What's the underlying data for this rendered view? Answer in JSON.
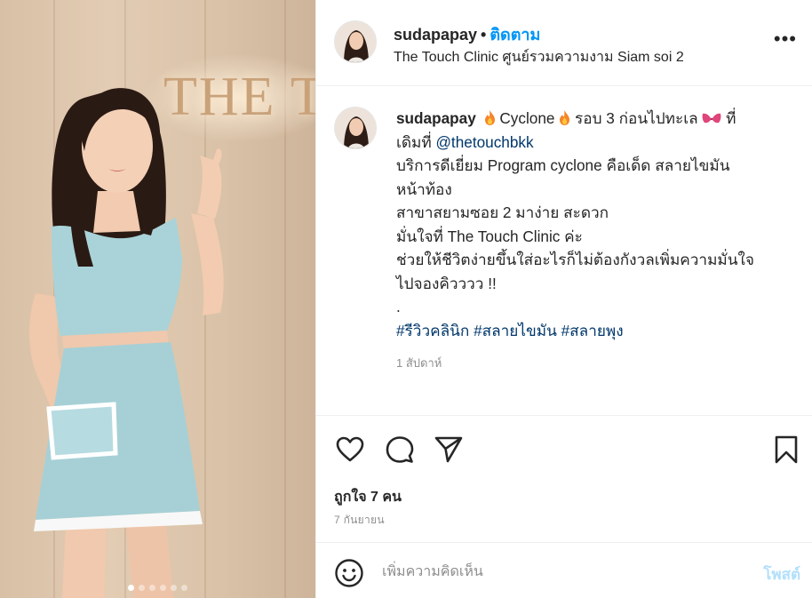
{
  "post": {
    "username": "sudapapay",
    "separator": "•",
    "follow_label": "ติดตาม",
    "location": "The Touch Clinic ศูนย์รวมความงาม Siam soi 2",
    "more_label": "•••"
  },
  "photo": {
    "sign_text": "THE TO",
    "carousel_count": 6,
    "carousel_active_index": 0
  },
  "caption": {
    "username": "sudapapay",
    "line1_a": "Cyclone",
    "line1_b": "รอบ 3 ก่อนไปทะเล",
    "line1_c": "ที่",
    "line2_prefix": "เดิมที่ ",
    "mention": "@thetouchbkk",
    "line3": "บริการดีเยี่ยม Program cyclone คือเด็ด สลายไขมัน",
    "line4": "หน้าท้อง",
    "line5": "สาขาสยามซอย 2 มาง่าย สะดวก",
    "line6": "มั่นใจที่ The Touch Clinic ค่ะ",
    "line7": "ช่วยให้ชีวิตง่ายขึ้นใส่อะไรก็ไม่ต้องกังวลเพิ่มความมั่นใจ",
    "line8": "ไปจองคิวววว !!",
    "line9": ".",
    "hashtags": [
      "#รีวิวคลินิก",
      "#สลายไขมัน",
      "#สลายพุง"
    ],
    "time_ago": "1 สัปดาห์"
  },
  "actions": {
    "like_icon": "heart-outline-icon",
    "comment_icon": "comment-bubble-icon",
    "share_icon": "paper-plane-icon",
    "save_icon": "bookmark-outline-icon"
  },
  "stats": {
    "likes_text": "ถูกใจ 7 คน",
    "date_text": "7 กันยายน"
  },
  "comment": {
    "placeholder": "เพิ่มความคิดเห็น",
    "post_label": "โพสต์",
    "post_label_color": "#b2dffc"
  },
  "colors": {
    "accent": "#0095f6",
    "link": "#00376b",
    "muted": "#8e8e8e"
  }
}
